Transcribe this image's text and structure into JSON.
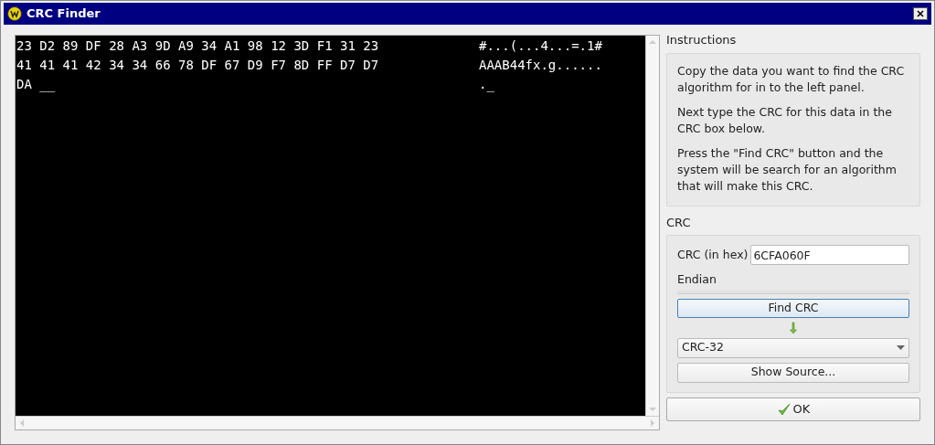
{
  "window": {
    "title": "CRC Finder"
  },
  "hex_view": {
    "rows": [
      {
        "hex": "23 D2 89 DF 28 A3 9D A9 34 A1 98 12 3D F1 31 23",
        "ascii": "#...(...4...=.1#"
      },
      {
        "hex": "41 41 41 42 34 34 66 78 DF 67 D9 F7 8D FF D7 D7",
        "ascii": "AAAB44fx.g......"
      },
      {
        "hex": "DA __",
        "ascii": "._"
      }
    ]
  },
  "instructions": {
    "title": "Instructions",
    "paragraphs": [
      "Copy the data you want to find the CRC algorithm for in to the left panel.",
      "Next type the CRC for this data in the CRC box below.",
      "Press the \"Find CRC\" button and the system will be search for an algorithm that will make this CRC."
    ]
  },
  "crc": {
    "title": "CRC",
    "field_label": "CRC (in hex)",
    "field_value": "6CFA060F",
    "endian_label": "Endian",
    "find_button": "Find CRC",
    "algorithm": "CRC-32",
    "source_button": "Show Source..."
  },
  "ok_button": "OK"
}
